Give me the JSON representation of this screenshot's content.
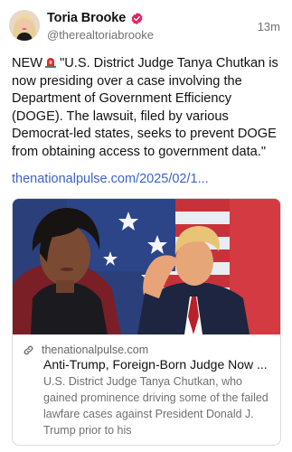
{
  "post": {
    "author": {
      "display_name": "Toria Brooke",
      "handle": "@therealtoriabrooke",
      "verified": true,
      "avatar_icon": "author-avatar",
      "verified_icon": "verified-badge-icon"
    },
    "timestamp": "13m",
    "body_lines": [
      {
        "before": "NEW",
        "icon": "siren-emoji-icon",
        "after": "\"U.S. District Judge Tanya Chutkan is"
      },
      {
        "text": "now presiding over a case involving the"
      },
      {
        "text": "Department of Government Efficiency"
      },
      {
        "text": "(DOGE). The lawsuit, filed by various"
      },
      {
        "text": "Democrat-led states, seeks to prevent DOGE"
      },
      {
        "text": "from obtaining access to government data.\""
      }
    ],
    "link_text": "thenationalpulse.com/2025/02/1...",
    "card": {
      "image_description_icon": "article-preview-image",
      "domain": "thenationalpulse.com",
      "title": "Anti-Trump, Foreign-Born Judge Now ...",
      "description_lines": [
        "U.S. District Judge Tanya Chutkan, who",
        "gained prominence driving some of the failed",
        "lawfare cases against President Donald J.",
        "Trump prior to his"
      ]
    }
  },
  "colors": {
    "link": "#3b63c9",
    "secondary_text": "#707070",
    "verified_badge": "#e0245e",
    "card_border": "#dcdcdc"
  }
}
